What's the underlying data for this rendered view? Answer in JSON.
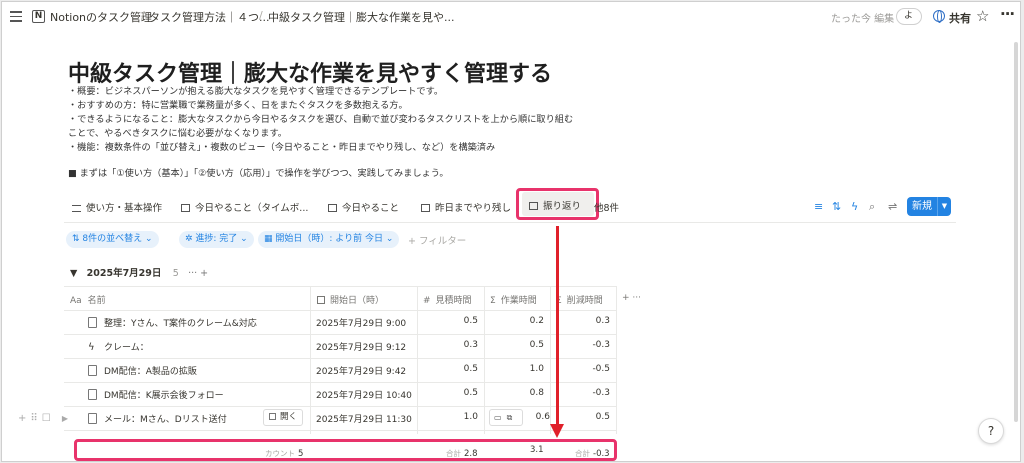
{
  "topbar": {
    "crumb1": "Notionのタスク管理",
    "crumb2": "タスク管理方法｜４つ...",
    "crumb3": "中級タスク管理｜膨大な作業を見や...",
    "edited": "たった今 編集",
    "avatar": "よ",
    "share": "共有"
  },
  "page": {
    "title": "中級タスク管理｜膨大な作業を見やすく管理する",
    "desc": [
      "・概要：ビジネスパーソンが抱える膨大なタスクを見やすく管理できるテンプレートです。",
      "・おすすめの方：特に営業職で業務量が多く、日をまたぐタスクを多数抱える方。",
      "・できるようになること：膨大なタスクから今日やるタスクを選び、自動で並び変わるタスクリストを上から順に取り組む",
      "ことで、やるべきタスクに悩む必要がなくなります。",
      "・機能：複数条件の「並び替え」・複数のビュー（今日やること・昨日までやり残し、など）を構築済み",
      "■ まずは「①使い方（基本）」「②使い方（応用）」で操作を学びつつ、実践してみましょう。"
    ]
  },
  "views": {
    "tab1": "使い方・基本操作",
    "tab2": "今日やること（タイムボ...",
    "tab3": "今日やること",
    "tab4": "昨日までやり残し",
    "tab5": "振り返り",
    "more": "他8件",
    "new_label": "新規"
  },
  "filters": {
    "sort": "8件の並べ替え",
    "progress": "進捗: 完了",
    "start": "開始日（時）: より前 今日",
    "add": "+ フィルター"
  },
  "group": {
    "label": "2025年7月29日",
    "count": "5",
    "actions": "··· +"
  },
  "columns": {
    "name": "名前",
    "start": "開始日（時）",
    "estimate": "見積時間",
    "work": "作業時間",
    "reduce": "削減時間",
    "name_icon": "Aa",
    "estimate_icon": "#",
    "work_icon": "Σ",
    "reduce_icon": "Σ",
    "add": "+ ···"
  },
  "rows": [
    {
      "icon": "doc-icon",
      "name": "整理：Yさん、T案件のクレーム&対応",
      "start": "2025年7月29日 9:00",
      "estimate": "0.5",
      "work": "0.2",
      "reduce": "0.3"
    },
    {
      "icon": "bolt-icon",
      "name": "クレーム：",
      "start": "2025年7月29日 9:12",
      "estimate": "0.3",
      "work": "0.5",
      "reduce": "-0.3"
    },
    {
      "icon": "doc-icon",
      "name": "DM配信：A製品の拡販",
      "start": "2025年7月29日 9:42",
      "estimate": "0.5",
      "work": "1.0",
      "reduce": "-0.5"
    },
    {
      "icon": "doc-icon",
      "name": "DM配信：K展示会後フォロー",
      "start": "2025年7月29日 10:40",
      "estimate": "0.5",
      "work": "0.8",
      "reduce": "-0.3"
    },
    {
      "icon": "doc-icon",
      "name": "メール：Mさん、Dリスト送付",
      "start": "2025年7月29日 11:30",
      "estimate": "1.0",
      "work": "0.6",
      "reduce": "0.5"
    }
  ],
  "row_actions": {
    "open": "開く"
  },
  "summary": {
    "count_label": "カウント",
    "count": "5",
    "estimate_label": "合計",
    "estimate": "2.8",
    "work": "3.1",
    "reduce_label": "合計",
    "reduce": "-0.3"
  },
  "colors": {
    "accent": "#2383e2",
    "highlight": "#e8336b",
    "arrow": "#e0202a"
  }
}
